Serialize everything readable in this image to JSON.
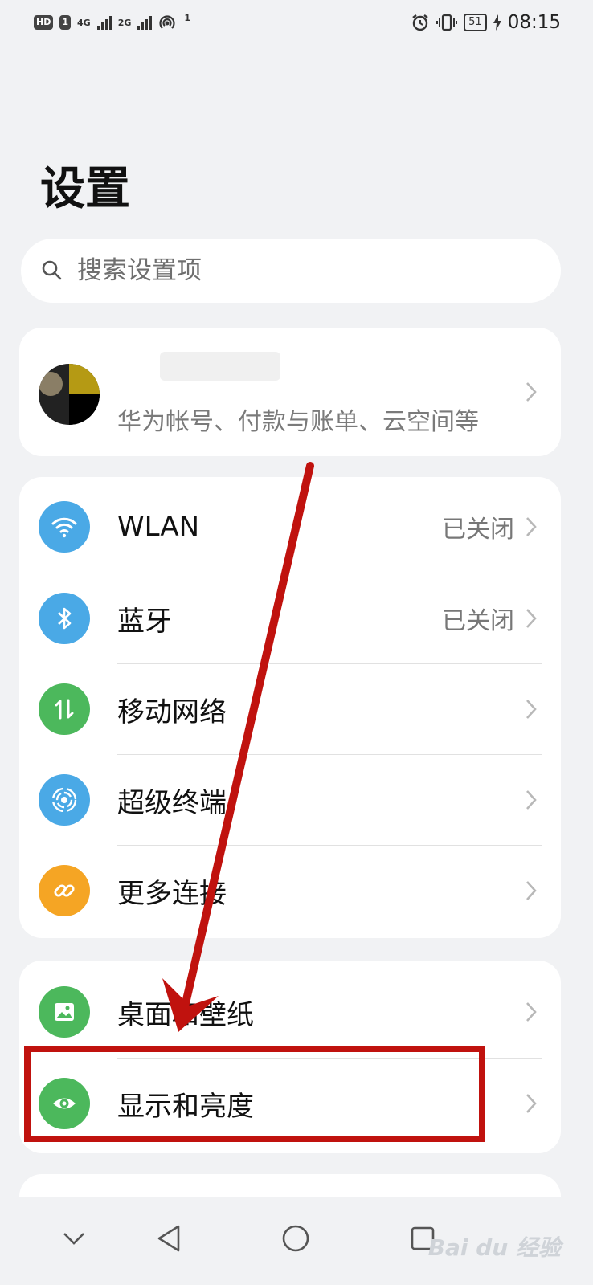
{
  "status_bar": {
    "left_badge": "HD",
    "sim1_network": "4G",
    "sim2_network": "2G",
    "hotspot_count": "1",
    "battery": "51",
    "time": "08:15"
  },
  "page": {
    "title": "设置"
  },
  "search": {
    "placeholder": "搜索设置项"
  },
  "account": {
    "subtitle": "华为帐号、付款与账单、云空间等"
  },
  "connectivity": [
    {
      "label": "WLAN",
      "value": "已关闭",
      "icon": "wifi-icon",
      "color": "#4aa9e6"
    },
    {
      "label": "蓝牙",
      "value": "已关闭",
      "icon": "bluetooth-icon",
      "color": "#4aa9e6"
    },
    {
      "label": "移动网络",
      "value": "",
      "icon": "mobile-data-icon",
      "color": "#4cb85c"
    },
    {
      "label": "超级终端",
      "value": "",
      "icon": "super-device-icon",
      "color": "#4aa9e6"
    },
    {
      "label": "更多连接",
      "value": "",
      "icon": "link-icon",
      "color": "#f5a524"
    }
  ],
  "display": [
    {
      "label": "桌面和壁纸",
      "icon": "wallpaper-icon",
      "color": "#4cb85c"
    },
    {
      "label": "显示和亮度",
      "icon": "eye-icon",
      "color": "#4cb85c"
    }
  ],
  "watermark": "Bai du 经验",
  "colors": {
    "annotation_red": "#c0120e",
    "background": "#f1f2f4"
  }
}
